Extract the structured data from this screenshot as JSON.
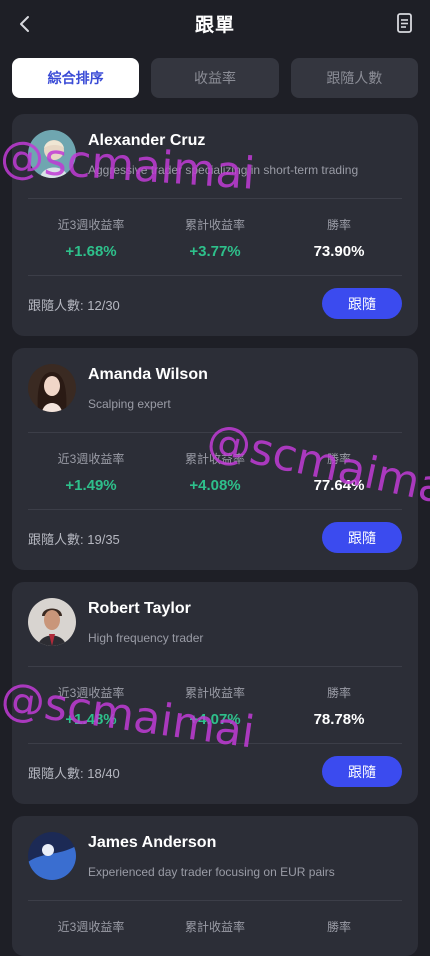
{
  "header": {
    "title": "跟單",
    "back_icon": "chevron-left-icon",
    "doc_icon": "document-icon"
  },
  "tabs": [
    {
      "label": "綜合排序",
      "active": true
    },
    {
      "label": "收益率",
      "active": false
    },
    {
      "label": "跟隨人數",
      "active": false
    }
  ],
  "traders": [
    {
      "name": "Alexander Cruz",
      "description": "Aggressive trader specializing in short-term trading",
      "stats": [
        {
          "label": "近3週收益率",
          "value": "+1.68%"
        },
        {
          "label": "累計收益率",
          "value": "+3.77%"
        },
        {
          "label": "勝率",
          "value": "73.90%"
        }
      ],
      "followers_label": "跟隨人數:",
      "followers_value": "12/30",
      "follow_label": "跟隨"
    },
    {
      "name": "Amanda Wilson",
      "description": "Scalping expert",
      "stats": [
        {
          "label": "近3週收益率",
          "value": "+1.49%"
        },
        {
          "label": "累計收益率",
          "value": "+4.08%"
        },
        {
          "label": "勝率",
          "value": "77.64%"
        }
      ],
      "followers_label": "跟隨人數:",
      "followers_value": "19/35",
      "follow_label": "跟隨"
    },
    {
      "name": "Robert Taylor",
      "description": "High frequency trader",
      "stats": [
        {
          "label": "近3週收益率",
          "value": "+1.48%"
        },
        {
          "label": "累計收益率",
          "value": "+4.07%"
        },
        {
          "label": "勝率",
          "value": "78.78%"
        }
      ],
      "followers_label": "跟隨人數:",
      "followers_value": "18/40",
      "follow_label": "跟隨"
    },
    {
      "name": "James Anderson",
      "description": "Experienced day trader focusing on EUR pairs",
      "stats": [
        {
          "label": "近3週收益率",
          "value": ""
        },
        {
          "label": "累計收益率",
          "value": ""
        },
        {
          "label": "勝率",
          "value": ""
        }
      ],
      "followers_label": "",
      "followers_value": "",
      "follow_label": ""
    }
  ],
  "watermark": "@scmaimai",
  "colors": {
    "background": "#1e1f26",
    "card": "#2c2e37",
    "accent": "#3b4bef",
    "positive": "#2ec08b",
    "watermark": "#c13bd6"
  }
}
